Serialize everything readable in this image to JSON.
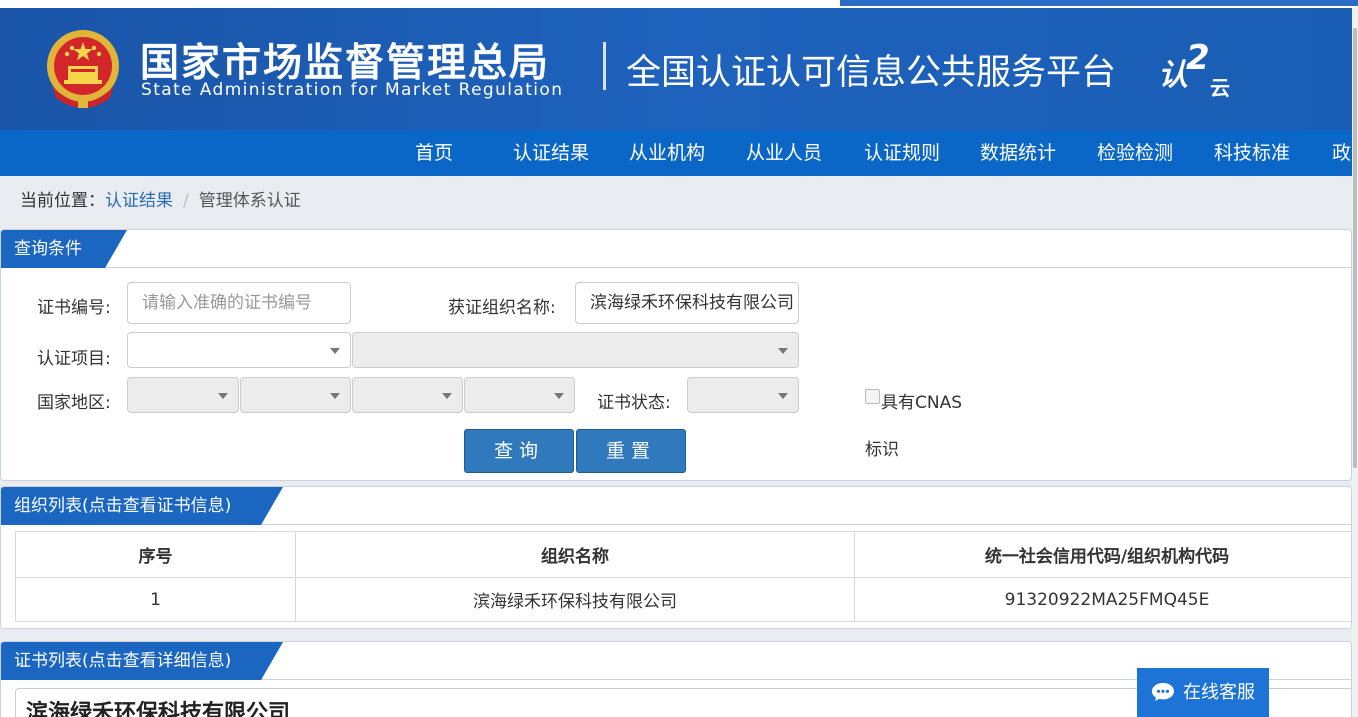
{
  "header": {
    "title_cn": "国家市场监督管理总局",
    "title_en": "State Administration  for  Market Regulation",
    "platform": "全国认证认可信息公共服务平台",
    "logo_ren": "认",
    "logo_2": "2",
    "logo_yun": "云",
    "colors": {
      "header_bg": "#1e62bd",
      "nav_bg": "#0a67c7",
      "accent": "#1a66c0"
    }
  },
  "nav": {
    "items": [
      {
        "label": "首页"
      },
      {
        "label": "认证结果"
      },
      {
        "label": "从业机构"
      },
      {
        "label": "从业人员"
      },
      {
        "label": "认证规则"
      },
      {
        "label": "数据统计"
      },
      {
        "label": "检验检测"
      },
      {
        "label": "科技标准"
      },
      {
        "label": "政"
      }
    ]
  },
  "breadcrumb": {
    "prefix": "当前位置：",
    "link": "认证结果",
    "sep": "/",
    "current": "管理体系认证"
  },
  "query": {
    "tab": "查询条件",
    "cert_no_label": "证书编号:",
    "cert_no_placeholder": "请输入准确的证书编号",
    "org_name_label": "获证组织名称:",
    "org_name_value": "滨海绿禾环保科技有限公司",
    "project_label": "认证项目:",
    "region_label": "国家地区:",
    "status_label": "证书状态:",
    "cnas_label": "具有CNAS",
    "cnas_label2": "标识",
    "search_button": "查询",
    "reset_button": "重置"
  },
  "org_list": {
    "tab": "组织列表(点击查看证书信息)",
    "columns": [
      "序号",
      "组织名称",
      "统一社会信用代码/组织机构代码"
    ],
    "rows": [
      {
        "index": "1",
        "name": "滨海绿禾环保科技有限公司",
        "code": "91320922MA25FMQ45E"
      }
    ]
  },
  "cert_list": {
    "tab": "证书列表(点击查看详细信息)",
    "org_name": "滨海绿禾环保科技有限公司"
  },
  "chat": {
    "label": "在线客服"
  }
}
